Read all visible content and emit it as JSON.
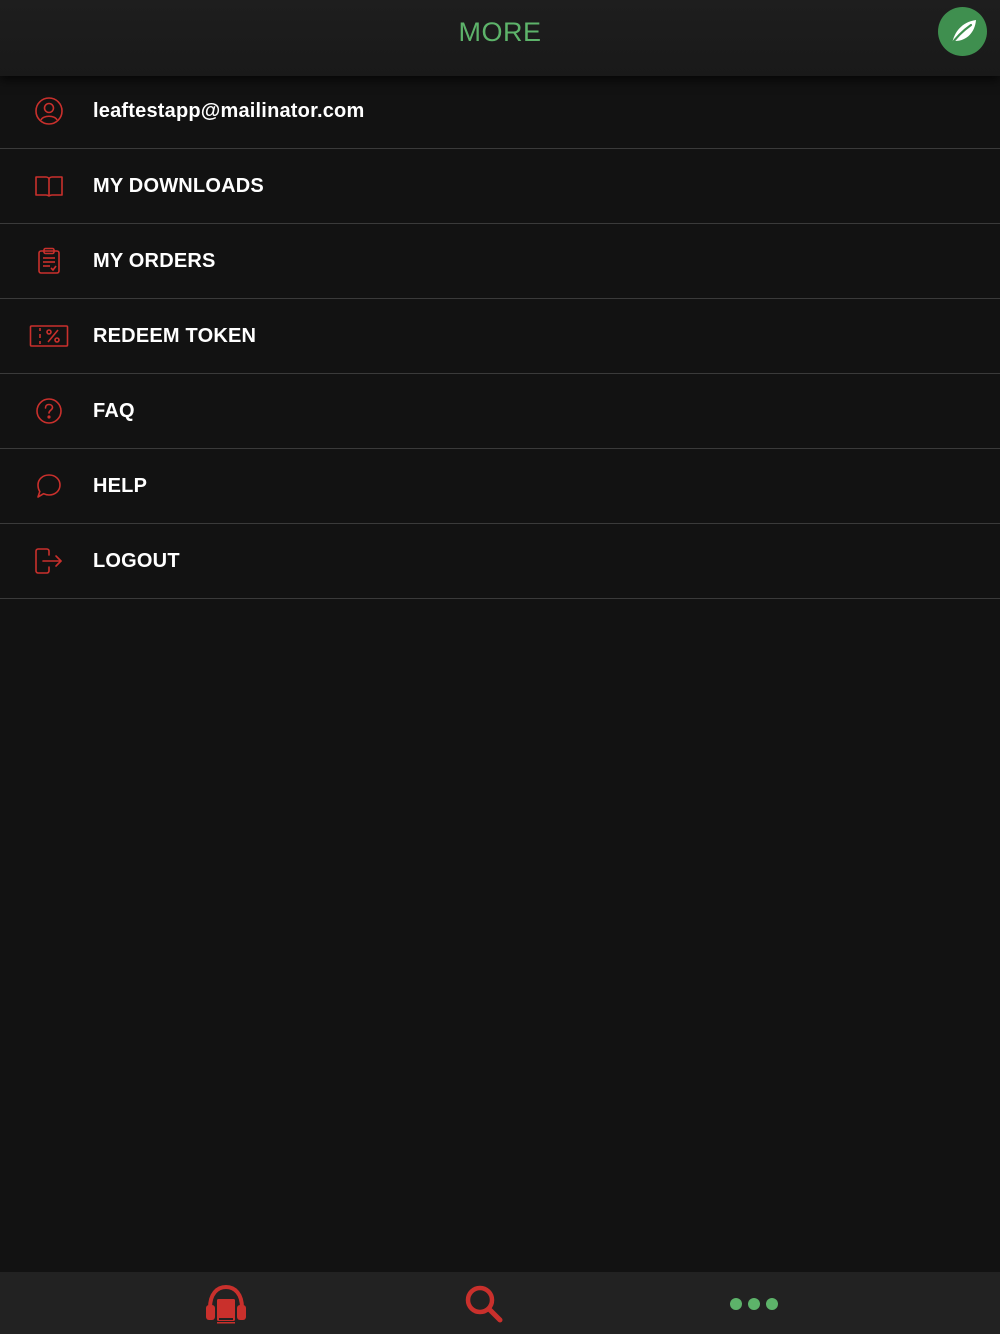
{
  "colors": {
    "background": "#121212",
    "accent_green": "#5db36a",
    "icon_red": "#c9302c",
    "logo_green": "#3f8f4f",
    "text_white": "#ffffff"
  },
  "header": {
    "title": "MORE",
    "logo_icon": "leaf-icon"
  },
  "menu": {
    "items": [
      {
        "label": "leaftestapp@mailinator.com",
        "icon": "user-icon"
      },
      {
        "label": "MY DOWNLOADS",
        "icon": "book-icon"
      },
      {
        "label": "MY ORDERS",
        "icon": "clipboard-icon"
      },
      {
        "label": "REDEEM TOKEN",
        "icon": "coupon-icon"
      },
      {
        "label": "FAQ",
        "icon": "question-icon"
      },
      {
        "label": "HELP",
        "icon": "chat-bubble-icon"
      },
      {
        "label": "LOGOUT",
        "icon": "logout-icon"
      }
    ]
  },
  "tabbar": {
    "tabs": [
      {
        "icon": "headphones-book-icon",
        "active": false
      },
      {
        "icon": "search-icon",
        "active": false
      },
      {
        "icon": "more-dots-icon",
        "active": true
      }
    ]
  }
}
